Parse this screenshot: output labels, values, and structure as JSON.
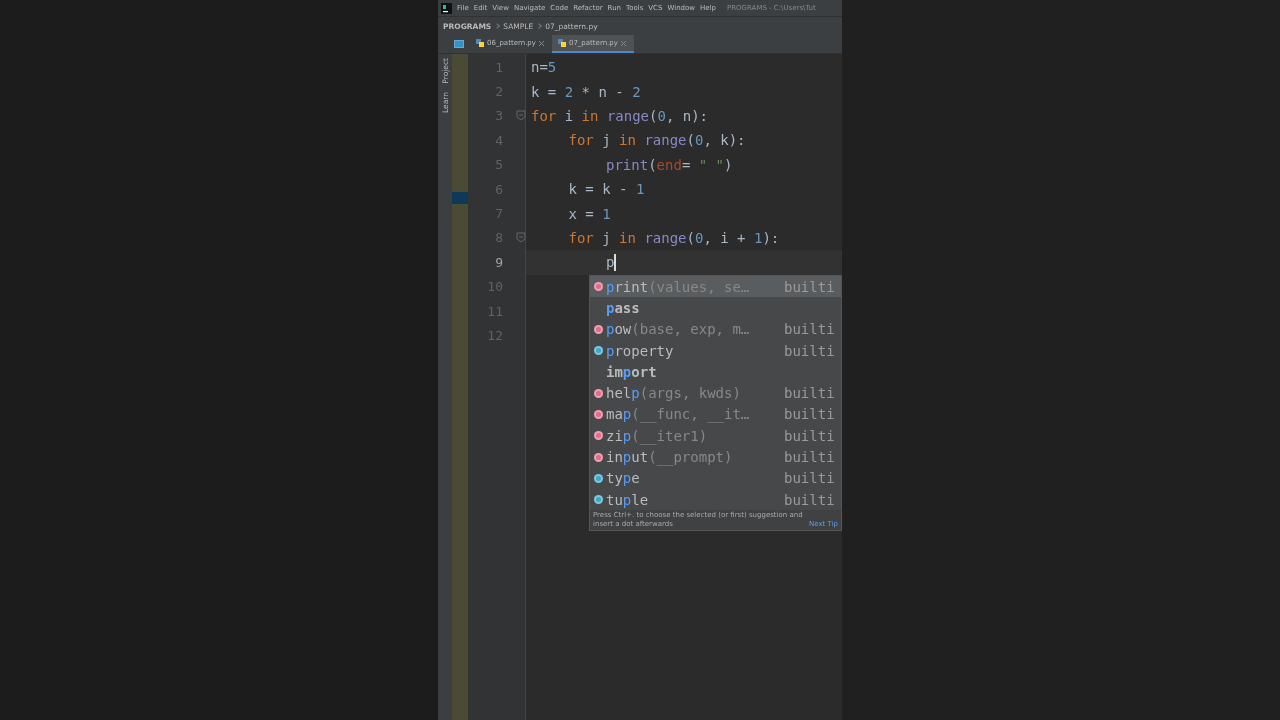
{
  "menu_bar": {
    "items": [
      "File",
      "Edit",
      "View",
      "Navigate",
      "Code",
      "Refactor",
      "Run",
      "Tools",
      "VCS",
      "Window",
      "Help"
    ],
    "title": "PROGRAMS - C:\\Users\\Tut"
  },
  "breadcrumbs": [
    "PROGRAMS",
    "SAMPLE",
    "07_pattern.py"
  ],
  "tabs": [
    {
      "label": "06_pattern.py",
      "selected": false
    },
    {
      "label": "07_pattern.py",
      "selected": true
    }
  ],
  "tool_strip": [
    "Project",
    "Learn"
  ],
  "editor": {
    "lines": [
      {
        "number": "1",
        "current": false,
        "fold": false,
        "tokens": [
          {
            "text": "n=",
            "color": "#a9b7c6"
          },
          {
            "text": "5",
            "color": "#6897bb"
          }
        ]
      },
      {
        "number": "2",
        "current": false,
        "fold": false,
        "tokens": [
          {
            "text": "k = ",
            "color": "#a9b7c6"
          },
          {
            "text": "2",
            "color": "#6897bb"
          },
          {
            "text": " * n - ",
            "color": "#a9b7c6"
          },
          {
            "text": "2",
            "color": "#6897bb"
          }
        ]
      },
      {
        "number": "3",
        "current": false,
        "fold": true,
        "tokens": [
          {
            "text": "for",
            "color": "#cc7832"
          },
          {
            "text": " i ",
            "color": "#a9b7c6"
          },
          {
            "text": "in",
            "color": "#cc7832"
          },
          {
            "text": " range",
            "color": "#8888c6"
          },
          {
            "text": "(",
            "color": "#a9b7c6"
          },
          {
            "text": "0",
            "color": "#6897bb"
          },
          {
            "text": ", n):",
            "color": "#a9b7c6"
          }
        ],
        "children": [
          {
            "number": "4",
            "current": false,
            "fold": false,
            "tokens": [
              {
                "text": "for",
                "color": "#cc7832"
              },
              {
                "text": " j ",
                "color": "#a9b7c6"
              },
              {
                "text": "in",
                "color": "#cc7832"
              },
              {
                "text": " range",
                "color": "#8888c6"
              },
              {
                "text": "(",
                "color": "#a9b7c6"
              },
              {
                "text": "0",
                "color": "#6897bb"
              },
              {
                "text": ", k):",
                "color": "#a9b7c6"
              }
            ],
            "children": [
              {
                "number": "5",
                "current": false,
                "fold": false,
                "tokens": [
                  {
                    "text": "print",
                    "color": "#8888c6"
                  },
                  {
                    "text": "(",
                    "color": "#a9b7c6"
                  },
                  {
                    "text": "end",
                    "color": "#aa4926"
                  },
                  {
                    "text": "= ",
                    "color": "#a9b7c6"
                  },
                  {
                    "text": "\" \"",
                    "color": "#6a8759"
                  },
                  {
                    "text": ")",
                    "color": "#a9b7c6"
                  }
                ]
              }
            ]
          },
          {
            "number": "6",
            "current": false,
            "fold": false,
            "tokens": [
              {
                "text": "k = k - ",
                "color": "#a9b7c6"
              },
              {
                "text": "1",
                "color": "#6897bb"
              }
            ]
          },
          {
            "number": "7",
            "current": false,
            "fold": false,
            "tokens": [
              {
                "text": "x = ",
                "color": "#a9b7c6"
              },
              {
                "text": "1",
                "color": "#6897bb"
              }
            ]
          },
          {
            "number": "8",
            "current": false,
            "fold": true,
            "tokens": [
              {
                "text": "for",
                "color": "#cc7832"
              },
              {
                "text": " j ",
                "color": "#a9b7c6"
              },
              {
                "text": "in",
                "color": "#cc7832"
              },
              {
                "text": " range",
                "color": "#8888c6"
              },
              {
                "text": "(",
                "color": "#a9b7c6"
              },
              {
                "text": "0",
                "color": "#6897bb"
              },
              {
                "text": ", i + ",
                "color": "#a9b7c6"
              },
              {
                "text": "1",
                "color": "#6897bb"
              },
              {
                "text": "):",
                "color": "#a9b7c6"
              }
            ],
            "children": [
              {
                "number": "9",
                "current": true,
                "fold": false,
                "tokens": [
                  {
                    "text": "p",
                    "color": "#a9b7c6"
                  }
                ]
              }
            ]
          }
        ]
      },
      {
        "number": "10",
        "current": false,
        "fold": false
      },
      {
        "number": "11",
        "current": false,
        "fold": false
      },
      {
        "number": "12",
        "current": false,
        "fold": false
      }
    ]
  },
  "completion": {
    "items": [
      {
        "kind": "function",
        "match": "p",
        "after": "rint",
        "signature": "(values, se…",
        "source": "builti",
        "selected": true
      },
      {
        "kind": "keyword",
        "match": "p",
        "after": "ass",
        "selected": false
      },
      {
        "kind": "function",
        "match": "p",
        "after": "ow",
        "signature": "(base, exp, m…",
        "source": "builti",
        "selected": false
      },
      {
        "kind": "class",
        "match": "p",
        "after": "roperty",
        "source": "builti",
        "selected": false
      },
      {
        "kind": "keyword",
        "before": "im",
        "match": "p",
        "after": "ort",
        "selected": false
      },
      {
        "kind": "function",
        "before": "hel",
        "match": "p",
        "signature": "(args, kwds)",
        "source": "builti",
        "selected": false
      },
      {
        "kind": "function",
        "before": "ma",
        "match": "p",
        "signature": "(__func, __it…",
        "source": "builti",
        "selected": false
      },
      {
        "kind": "function",
        "before": "zi",
        "match": "p",
        "signature": "(__iter1)",
        "source": "builti",
        "selected": false
      },
      {
        "kind": "function",
        "before": "in",
        "match": "p",
        "after": "ut",
        "signature": "(__prompt)",
        "source": "builti",
        "selected": false
      },
      {
        "kind": "class",
        "before": "ty",
        "match": "p",
        "after": "e",
        "source": "builti",
        "selected": false
      },
      {
        "kind": "class",
        "before": "tu",
        "match": "p",
        "after": "le",
        "source": "builti",
        "selected": false
      }
    ],
    "hint": "Press Ctrl+. to choose the selected (or first) suggestion and insert a dot afterwards",
    "hint_link": "Next Tip"
  }
}
